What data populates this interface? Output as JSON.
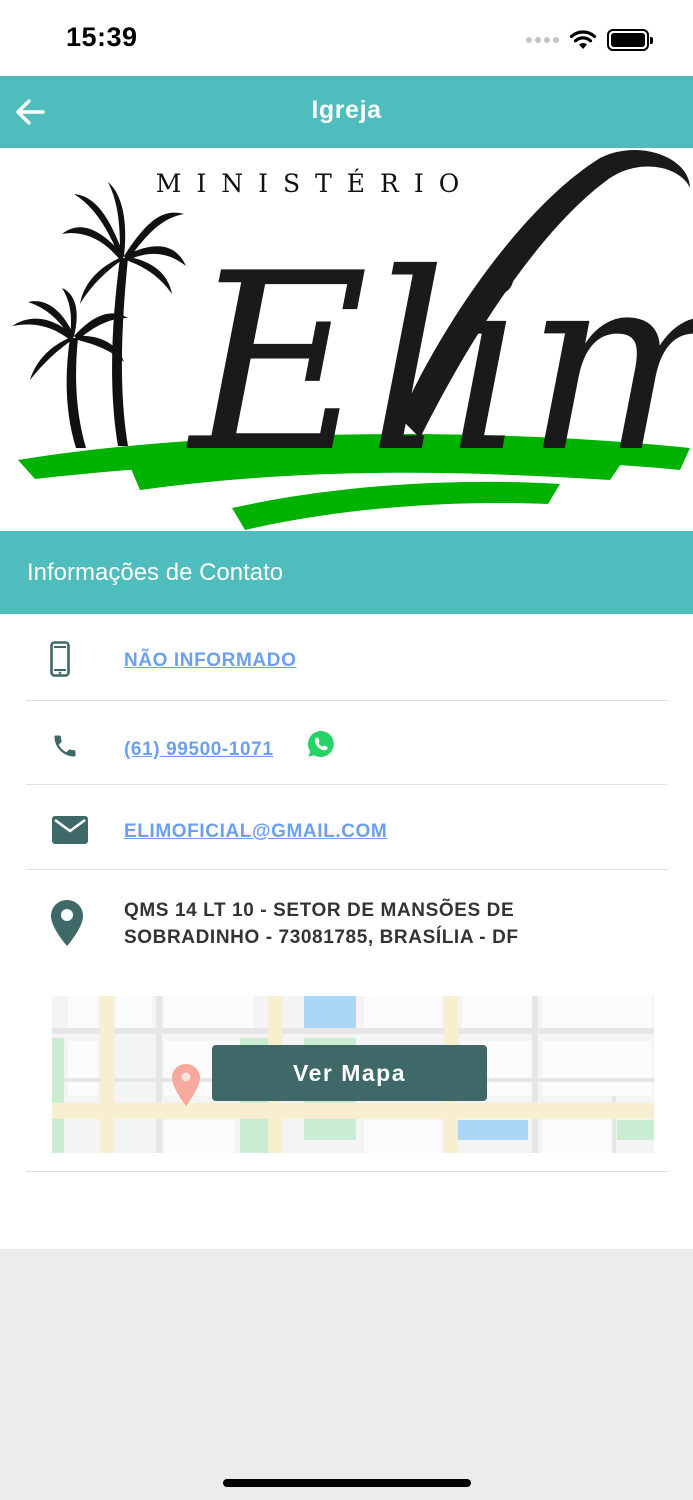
{
  "status_bar": {
    "time": "15:39"
  },
  "header": {
    "title": "Igreja"
  },
  "logo": {
    "top_text": "MINISTÉRIO",
    "script_text": "Elim"
  },
  "section": {
    "title": "Informações de Contato"
  },
  "contact": {
    "mobile": "NÃO INFORMADO",
    "phone": "(61) 99500-1071",
    "email": "ELIMOFICIAL@GMAIL.COM",
    "address_line1": "QMS 14 LT 10 - SETOR DE MANSÕES DE",
    "address_line2": "SOBRADINHO - 73081785, BRASÍLIA - DF"
  },
  "map": {
    "button_label": "Ver Mapa"
  },
  "colors": {
    "accent": "#4fbcbd",
    "icon": "#3f6868",
    "link": "#6b9ff0",
    "logo_green": "#00b200",
    "whatsapp": "#25d366"
  }
}
